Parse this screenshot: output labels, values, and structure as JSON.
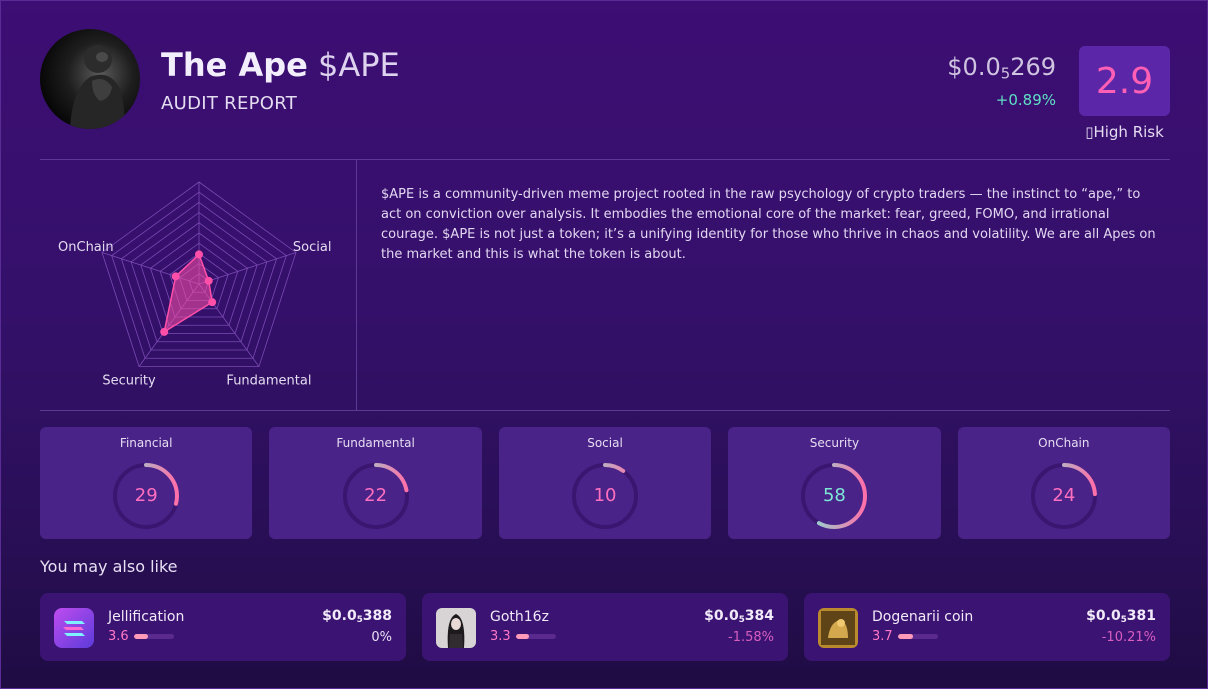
{
  "header": {
    "name": "The Ape",
    "ticker": "$APE",
    "subtitle": "AUDIT REPORT",
    "price_prefix": "$0.0",
    "price_zeros": "5",
    "price_digits": "269",
    "change": "+0.89%",
    "overall_score": "2.9",
    "risk_label": "High Risk"
  },
  "radar": {
    "axes": [
      "Financial",
      "Social",
      "Fundamental",
      "Security",
      "OnChain"
    ],
    "values": [
      29,
      10,
      22,
      58,
      24
    ],
    "max": 100,
    "color": "#ff4fa8"
  },
  "description": "$APE is a community-driven meme project rooted in the raw psychology of crypto traders — the instinct to “ape,” to act on conviction over analysis. It embodies the emotional core of the market: fear, greed, FOMO, and irrational courage. $APE is not just a token; it’s a unifying identity for those who thrive in chaos and volatility. We are all Apes on the market and this is what the token is about.",
  "scores": [
    {
      "label": "Financial",
      "value": 29
    },
    {
      "label": "Fundamental",
      "value": 22
    },
    {
      "label": "Social",
      "value": 10
    },
    {
      "label": "Security",
      "value": 58
    },
    {
      "label": "OnChain",
      "value": 24
    }
  ],
  "also_like": {
    "title": "You may also like",
    "items": [
      {
        "name": "Jellification",
        "score": "3.6",
        "score_fraction": 0.36,
        "price_prefix": "$0.0",
        "price_zeros": "5",
        "price_digits": "388",
        "change": "0%",
        "change_color": "#e8e0f4",
        "icon": "jelly-icon"
      },
      {
        "name": "Goth16z",
        "score": "3.3",
        "score_fraction": 0.33,
        "price_prefix": "$0.0",
        "price_zeros": "5",
        "price_digits": "384",
        "change": "-1.58%",
        "change_color": "#d85ec0",
        "icon": "goth-avatar"
      },
      {
        "name": "Dogenarii coin",
        "score": "3.7",
        "score_fraction": 0.37,
        "price_prefix": "$0.0",
        "price_zeros": "5",
        "price_digits": "381",
        "change": "-10.21%",
        "change_color": "#d85ec0",
        "icon": "dogenarii-avatar"
      }
    ]
  }
}
